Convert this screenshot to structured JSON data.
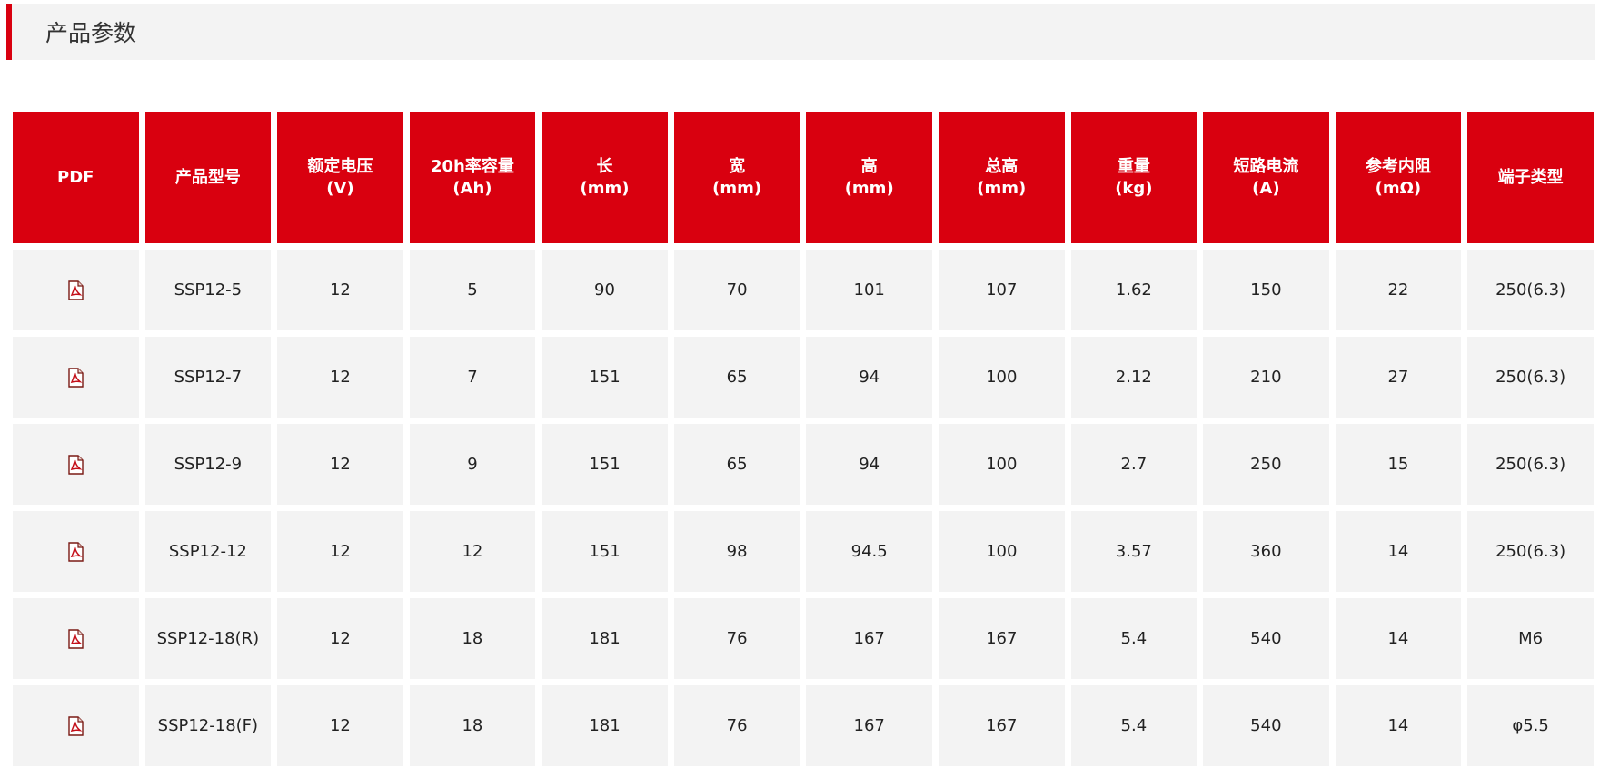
{
  "section": {
    "title": "产品参数"
  },
  "table": {
    "columns": [
      {
        "line1": "PDF",
        "line2": ""
      },
      {
        "line1": "产品型号",
        "line2": ""
      },
      {
        "line1": "额定电压",
        "line2": "(V)"
      },
      {
        "line1": "20h率容量",
        "line2": "(Ah)"
      },
      {
        "line1": "长",
        "line2": "(mm)"
      },
      {
        "line1": "宽",
        "line2": "(mm)"
      },
      {
        "line1": "高",
        "line2": "(mm)"
      },
      {
        "line1": "总高",
        "line2": "(mm)"
      },
      {
        "line1": "重量",
        "line2": "(kg)"
      },
      {
        "line1": "短路电流",
        "line2": "(A)"
      },
      {
        "line1": "参考内阻",
        "line2": "(mΩ)"
      },
      {
        "line1": "端子类型",
        "line2": ""
      }
    ],
    "rows": [
      {
        "pdf_icon": "pdf-file-icon",
        "cells": [
          "SSP12-5",
          "12",
          "5",
          "90",
          "70",
          "101",
          "107",
          "1.62",
          "150",
          "22",
          "250(6.3)"
        ]
      },
      {
        "pdf_icon": "pdf-file-icon",
        "cells": [
          "SSP12-7",
          "12",
          "7",
          "151",
          "65",
          "94",
          "100",
          "2.12",
          "210",
          "27",
          "250(6.3)"
        ]
      },
      {
        "pdf_icon": "pdf-file-icon",
        "cells": [
          "SSP12-9",
          "12",
          "9",
          "151",
          "65",
          "94",
          "100",
          "2.7",
          "250",
          "15",
          "250(6.3)"
        ]
      },
      {
        "pdf_icon": "pdf-file-icon",
        "cells": [
          "SSP12-12",
          "12",
          "12",
          "151",
          "98",
          "94.5",
          "100",
          "3.57",
          "360",
          "14",
          "250(6.3)"
        ]
      },
      {
        "pdf_icon": "pdf-file-icon",
        "cells": [
          "SSP12-18(R)",
          "12",
          "18",
          "181",
          "76",
          "167",
          "167",
          "5.4",
          "540",
          "14",
          "M6"
        ]
      },
      {
        "pdf_icon": "pdf-file-icon",
        "cells": [
          "SSP12-18(F)",
          "12",
          "18",
          "181",
          "76",
          "167",
          "167",
          "5.4",
          "540",
          "14",
          "φ5.5"
        ]
      }
    ]
  },
  "colors": {
    "accent": "#d9000f",
    "header_text": "#ffffff",
    "cell_bg": "#f3f3f3",
    "cell_text": "#222222"
  }
}
